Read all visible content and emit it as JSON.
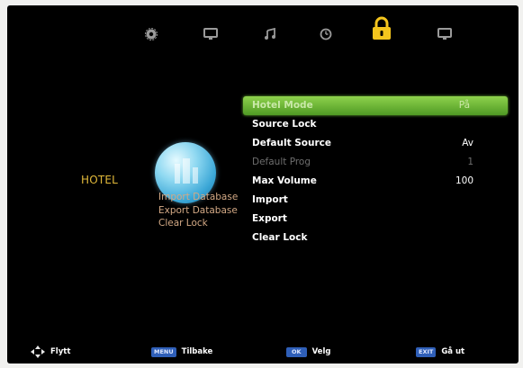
{
  "top_tabs": [
    {
      "icon": "gear-icon",
      "active": false
    },
    {
      "icon": "monitor-icon",
      "active": false
    },
    {
      "icon": "music-note-icon",
      "active": false
    },
    {
      "icon": "clock-icon",
      "active": false
    },
    {
      "icon": "lock-icon",
      "active": true
    },
    {
      "icon": "monitor-icon",
      "active": false
    }
  ],
  "left_panel": {
    "title": "HOTEL",
    "items": [
      "Import Database",
      "Export Database",
      "Clear Lock"
    ]
  },
  "menu": {
    "items": [
      {
        "label": "Hotel Mode",
        "value": "På"
      },
      {
        "label": "Source Lock",
        "value": ""
      },
      {
        "label": "Default Source",
        "value": "Av"
      },
      {
        "label": "Default Prog",
        "value": "1"
      },
      {
        "label": "Max Volume",
        "value": "100"
      },
      {
        "label": "Import",
        "value": ""
      },
      {
        "label": "Export",
        "value": ""
      },
      {
        "label": "Clear Lock",
        "value": ""
      }
    ]
  },
  "footer": {
    "move_label": "Flytt",
    "menu_key": "MENU",
    "back_label": "Tilbake",
    "ok_key": "OK",
    "select_label": "Velg",
    "exit_key": "EXIT",
    "exit_label": "Gå ut"
  },
  "colors": {
    "accent_yellow": "#f4c51d",
    "selection_green": "#6fbb36",
    "panel_bg": "#000000",
    "key_blue": "#2f5fb8"
  }
}
